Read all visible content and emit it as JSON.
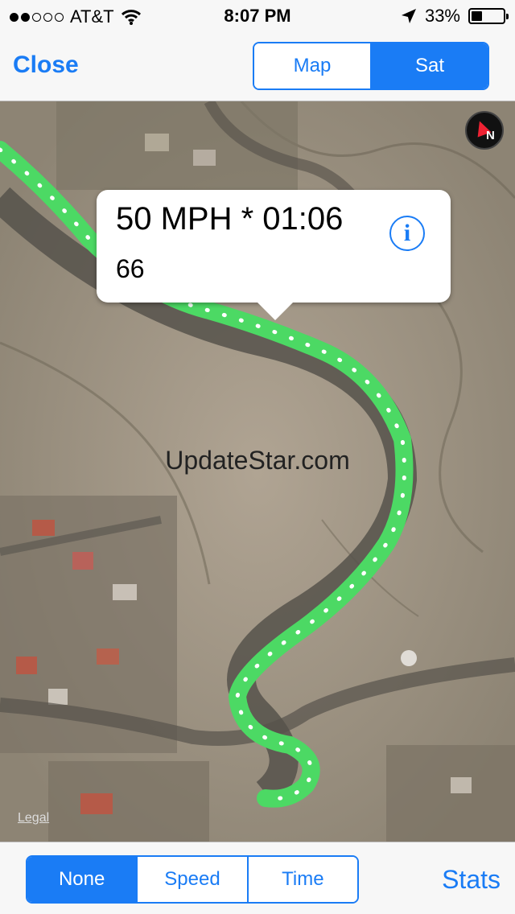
{
  "status": {
    "carrier": "AT&T",
    "time": "8:07 PM",
    "battery_text": "33%",
    "battery_level": 0.33,
    "signal_bars": 2,
    "icons": [
      "signal-dots-icon",
      "wifi-icon",
      "location-arrow-icon",
      "battery-icon"
    ]
  },
  "nav": {
    "close_label": "Close",
    "map_types": [
      {
        "label": "Map",
        "selected": false
      },
      {
        "label": "Sat",
        "selected": true
      }
    ]
  },
  "map": {
    "callout": {
      "title": "50 MPH * 01:06",
      "subtitle": "66"
    },
    "watermark": "UpdateStar.com",
    "legal": "Legal",
    "compass_letter": "N",
    "route_color": "#4cd964"
  },
  "toolbar": {
    "filters": [
      {
        "label": "None",
        "selected": true
      },
      {
        "label": "Speed",
        "selected": false
      },
      {
        "label": "Time",
        "selected": false
      }
    ],
    "stats_label": "Stats"
  },
  "colors": {
    "accent": "#1a7cf5",
    "bar_background": "#f7f7f7"
  }
}
